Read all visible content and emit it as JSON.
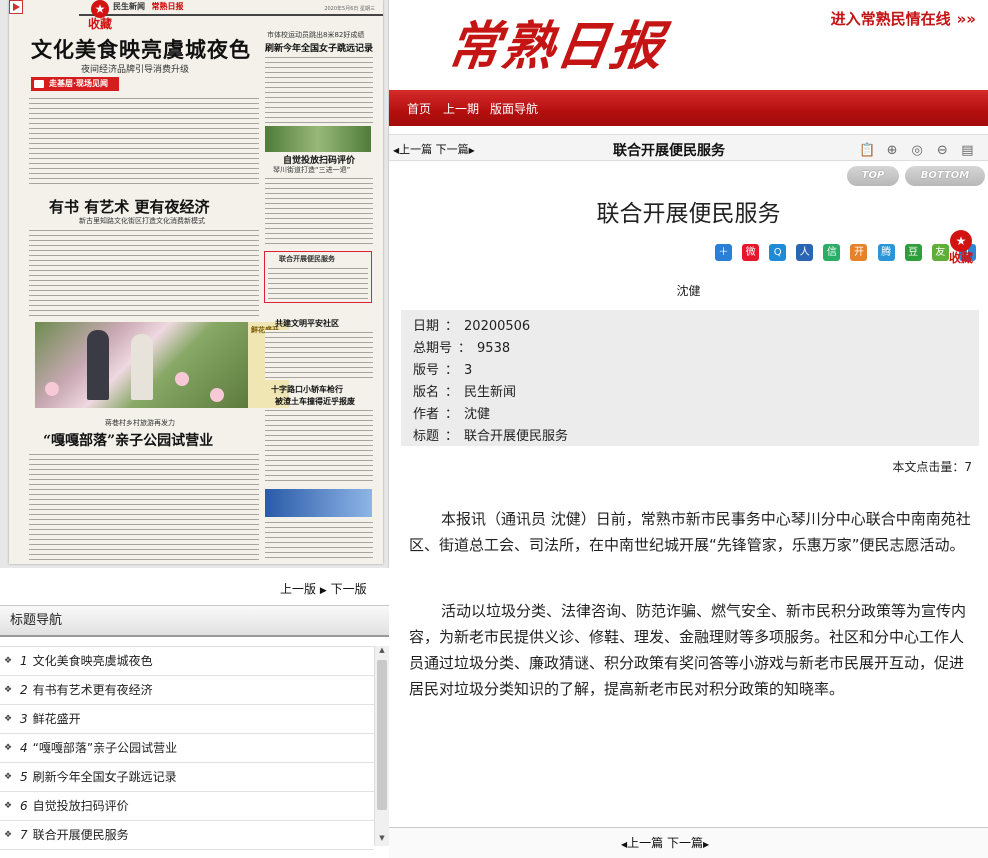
{
  "paper": {
    "header_brand": "民生新闻",
    "header_brand2": "常熟日报",
    "header_meta": "2020年5月6日 星期三",
    "fav_label": "收藏",
    "headline": "文化美食映亮虞城夜色",
    "subheadline": "夜间经济品牌引导消费升级",
    "section_tag": "走基层·现场见闻",
    "headline2": "有书 有艺术 更有夜经济",
    "subheadline2": "新古里知路文化街区打造文化消费新模式",
    "photo_caption": "鲜花盛开",
    "headline3_kicker": "蒋巷村乡村旅游再发力",
    "headline3": "“嘎嘎部落”亲子公园试营业",
    "right_top_kicker": "市体校运动员跳出8米82好成绩",
    "right_top_title": "刷新今年全国女子跳远记录",
    "right_mid_title": "自觉投放扫码评价",
    "right_mid_sub": "琴川街道打造“三进一退”",
    "boxed_title": "联合开展便民服务",
    "right_low_title": "共建文明平安社区",
    "right_low2_title": "十字路口小轿车枪行",
    "right_low2_sub": "被渣土车撞得近乎报废"
  },
  "pager_left": {
    "prev": "上一版",
    "sep": "▶",
    "next": "下一版"
  },
  "title_nav": {
    "heading": "标题导航",
    "items": [
      {
        "num": "1",
        "label": "文化美食映亮虞城夜色"
      },
      {
        "num": "2",
        "label": "有书有艺术更有夜经济"
      },
      {
        "num": "3",
        "label": "鲜花盛开"
      },
      {
        "num": "4",
        "label": "“嘎嘎部落”亲子公园试营业"
      },
      {
        "num": "5",
        "label": "刷新今年全国女子跳远记录"
      },
      {
        "num": "6",
        "label": "自觉投放扫码评价"
      },
      {
        "num": "7",
        "label": "联合开展便民服务"
      }
    ]
  },
  "banner": {
    "logo": "常熟日报",
    "enter_link": "进入常熟民情在线",
    "enter_arrows": "»»"
  },
  "topnav": {
    "home": "首页",
    "prev_issue": "上一期",
    "layout_nav": "版面导航"
  },
  "toolbar": {
    "prev": "上一篇",
    "next": "下一篇",
    "title": "联合开展便民服务"
  },
  "scroll_buttons": {
    "top": "TOP",
    "bottom": "BOTTOM"
  },
  "article": {
    "title": "联合开展便民服务",
    "author": "沈健",
    "meta": [
      {
        "key": "日期",
        "value": "20200506"
      },
      {
        "key": "总期号",
        "value": "9538"
      },
      {
        "key": "版号",
        "value": "3"
      },
      {
        "key": "版名",
        "value": "民生新闻"
      },
      {
        "key": "作者",
        "value": "沈健"
      },
      {
        "key": "标题",
        "value": "联合开展便民服务"
      }
    ],
    "hits_label": "本文点击量：",
    "hits_value": "7",
    "p1": "本报讯（通讯员 沈健）日前，常熟市新市民事务中心琴川分中心联合中南南苑社区、街道总工会、司法所，在中南世纪城开展“先锋管家，乐惠万家”便民志愿活动。",
    "p2": "活动以垃圾分类、法律咨询、防范诈骗、燃气安全、新市民积分政策等为宣传内容，为新老市民提供义诊、修鞋、理发、金融理财等多项服务。社区和分中心工作人员通过垃圾分类、廉政猜谜、积分政策有奖问答等小游戏与新老市民展开互动，促进居民对垃圾分类知识的了解，提高新老市民对积分政策的知晓率。"
  },
  "share": {
    "fav_label": "收藏",
    "icons": [
      "plus-share-icon",
      "weibo-icon",
      "qzone-icon",
      "renren-icon",
      "wechat-icon",
      "kaixin-icon",
      "tqq-icon",
      "douban-icon",
      "pengyou-icon",
      "one-icon"
    ]
  },
  "colors": {
    "brand_red": "#c41414",
    "nav_red": "#b40f0f",
    "meta_bg": "#ececec"
  }
}
